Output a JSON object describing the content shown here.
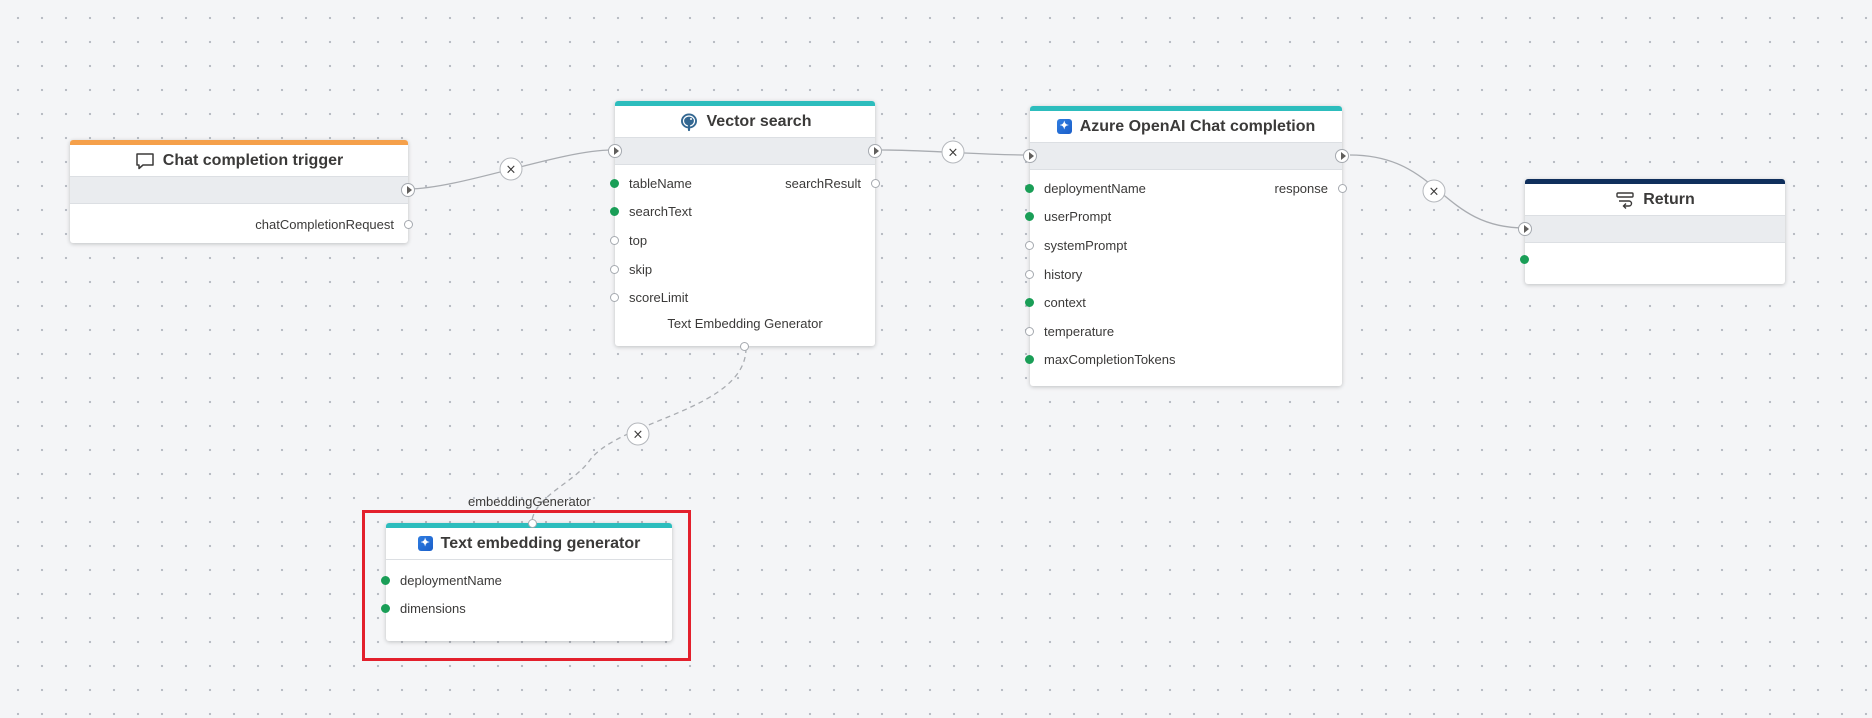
{
  "colors": {
    "trigger_accent": "#f5a04a",
    "teal_accent": "#2dbdbd",
    "return_accent": "#0f2f5c",
    "port_filled": "#1a9e57",
    "selection": "#e3202c"
  },
  "nodes": {
    "chat_trigger": {
      "title": "Chat completion trigger",
      "icon": "chat-bubble-icon",
      "outputs": [
        "chatCompletionRequest"
      ]
    },
    "vector_search": {
      "title": "Vector search",
      "icon": "postgresql-elephant-icon",
      "inputs": [
        {
          "label": "tableName",
          "required": true
        },
        {
          "label": "searchText",
          "required": true
        },
        {
          "label": "top",
          "required": false
        },
        {
          "label": "skip",
          "required": false
        },
        {
          "label": "scoreLimit",
          "required": false
        }
      ],
      "outputs": [
        "searchResult"
      ],
      "sublabel": "Text Embedding Generator"
    },
    "azure_chat": {
      "title": "Azure OpenAI Chat completion",
      "icon": "azure-openai-icon",
      "inputs": [
        {
          "label": "deploymentName",
          "required": true
        },
        {
          "label": "userPrompt",
          "required": true
        },
        {
          "label": "systemPrompt",
          "required": false
        },
        {
          "label": "history",
          "required": false
        },
        {
          "label": "context",
          "required": true
        },
        {
          "label": "temperature",
          "required": false
        },
        {
          "label": "maxCompletionTokens",
          "required": true
        }
      ],
      "outputs": [
        "response"
      ]
    },
    "return": {
      "title": "Return",
      "icon": "return-icon"
    },
    "text_embedding": {
      "title": "Text embedding generator",
      "icon": "azure-openai-icon",
      "top_label": "embeddingGenerator",
      "inputs": [
        {
          "label": "deploymentName",
          "required": true
        },
        {
          "label": "dimensions",
          "required": true
        }
      ]
    }
  },
  "edge_remove_symbol": "×"
}
